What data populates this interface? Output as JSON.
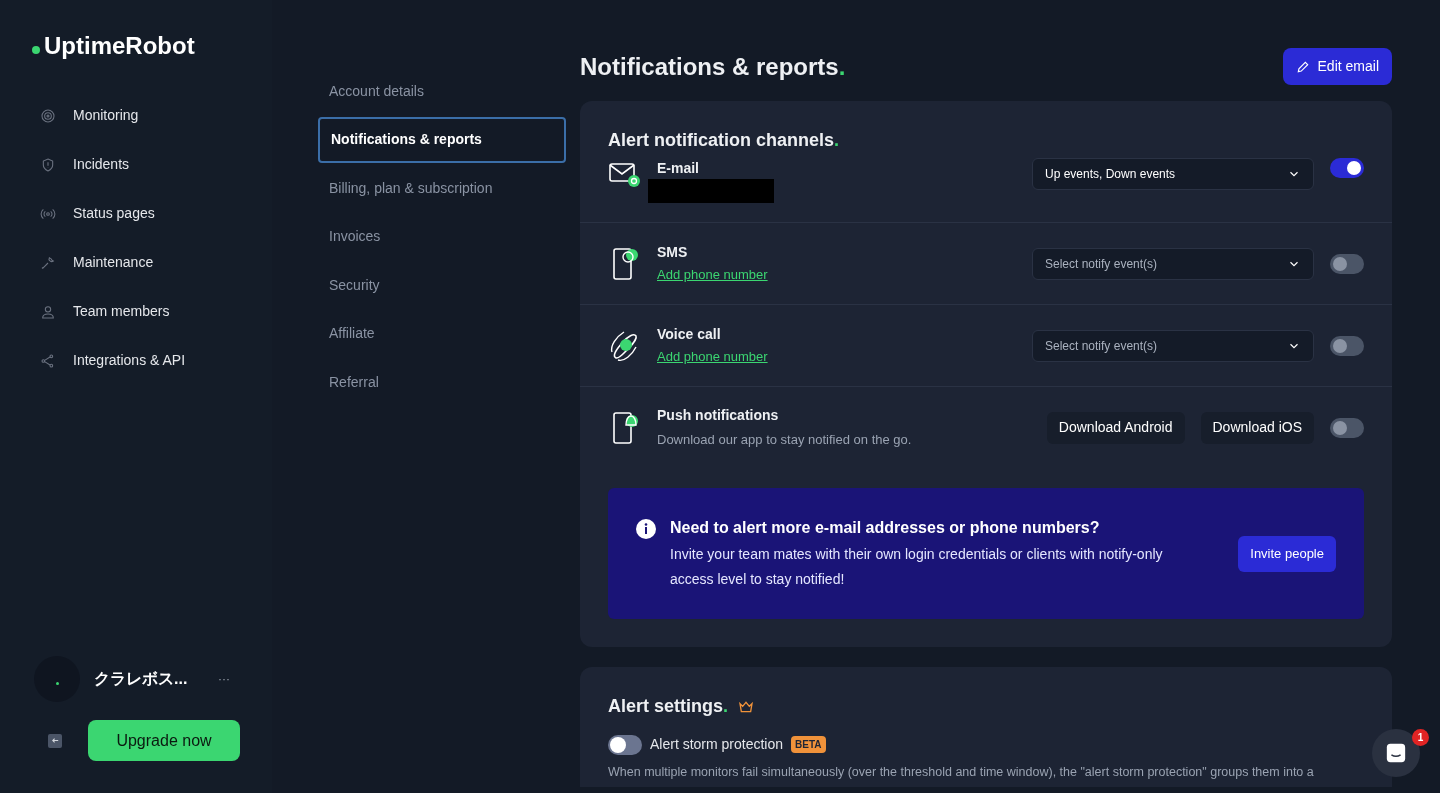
{
  "brand": {
    "name": "UptimeRobot"
  },
  "sidebar": {
    "items": [
      {
        "label": "Monitoring",
        "selected": false
      },
      {
        "label": "Incidents",
        "selected": false
      },
      {
        "label": "Status pages",
        "selected": false
      },
      {
        "label": "Maintenance",
        "selected": false
      },
      {
        "label": "Team members",
        "selected": false
      },
      {
        "label": "Integrations & API",
        "selected": false
      }
    ],
    "user": {
      "name": "クラレボス...",
      "menu": "···"
    },
    "upgrade_button": "Upgrade now"
  },
  "settings_nav": [
    {
      "label": "Account details",
      "selected": false
    },
    {
      "label": "Notifications & reports",
      "selected": true
    },
    {
      "label": "Billing, plan & subscription",
      "selected": false
    },
    {
      "label": "Invoices",
      "selected": false
    },
    {
      "label": "Security",
      "selected": false
    },
    {
      "label": "Affiliate",
      "selected": false
    },
    {
      "label": "Referral",
      "selected": false
    }
  ],
  "page": {
    "title": "Notifications & reports",
    "title_accent": ".",
    "edit_button": "Edit email"
  },
  "channels_card": {
    "title": "Alert notification channels",
    "title_accent": ".",
    "channels": [
      {
        "kind": "email",
        "title": "E-mail",
        "redacted": true,
        "select": {
          "value": "Up events, Down events"
        },
        "on": true
      },
      {
        "kind": "sms",
        "title": "SMS",
        "link": "Add phone number",
        "select": {
          "placeholder": "Select notify event(s)"
        },
        "on": false
      },
      {
        "kind": "voice",
        "title": "Voice call",
        "link": "Add phone number",
        "select": {
          "placeholder": "Select notify event(s)"
        },
        "on": false
      },
      {
        "kind": "push",
        "title": "Push notifications",
        "subtitle": "Download our app to stay notified on the go.",
        "buttons": [
          "Download Android",
          "Download iOS"
        ],
        "on": false
      }
    ],
    "banner": {
      "title": "Need to alert more e-mail addresses or phone numbers?",
      "text": "Invite your team mates with their own login credentials or clients with notify-only access level to stay notified!",
      "button": "Invite people"
    }
  },
  "alert_settings": {
    "title": "Alert settings",
    "title_accent": ".",
    "storm": {
      "label": "Alert storm protection",
      "badge": "BETA",
      "on": false
    },
    "description": "When multiple monitors fail simultaneously (over the threshold and time window), the \"alert storm protection\" groups them into a"
  },
  "chat": {
    "badge": "1"
  }
}
